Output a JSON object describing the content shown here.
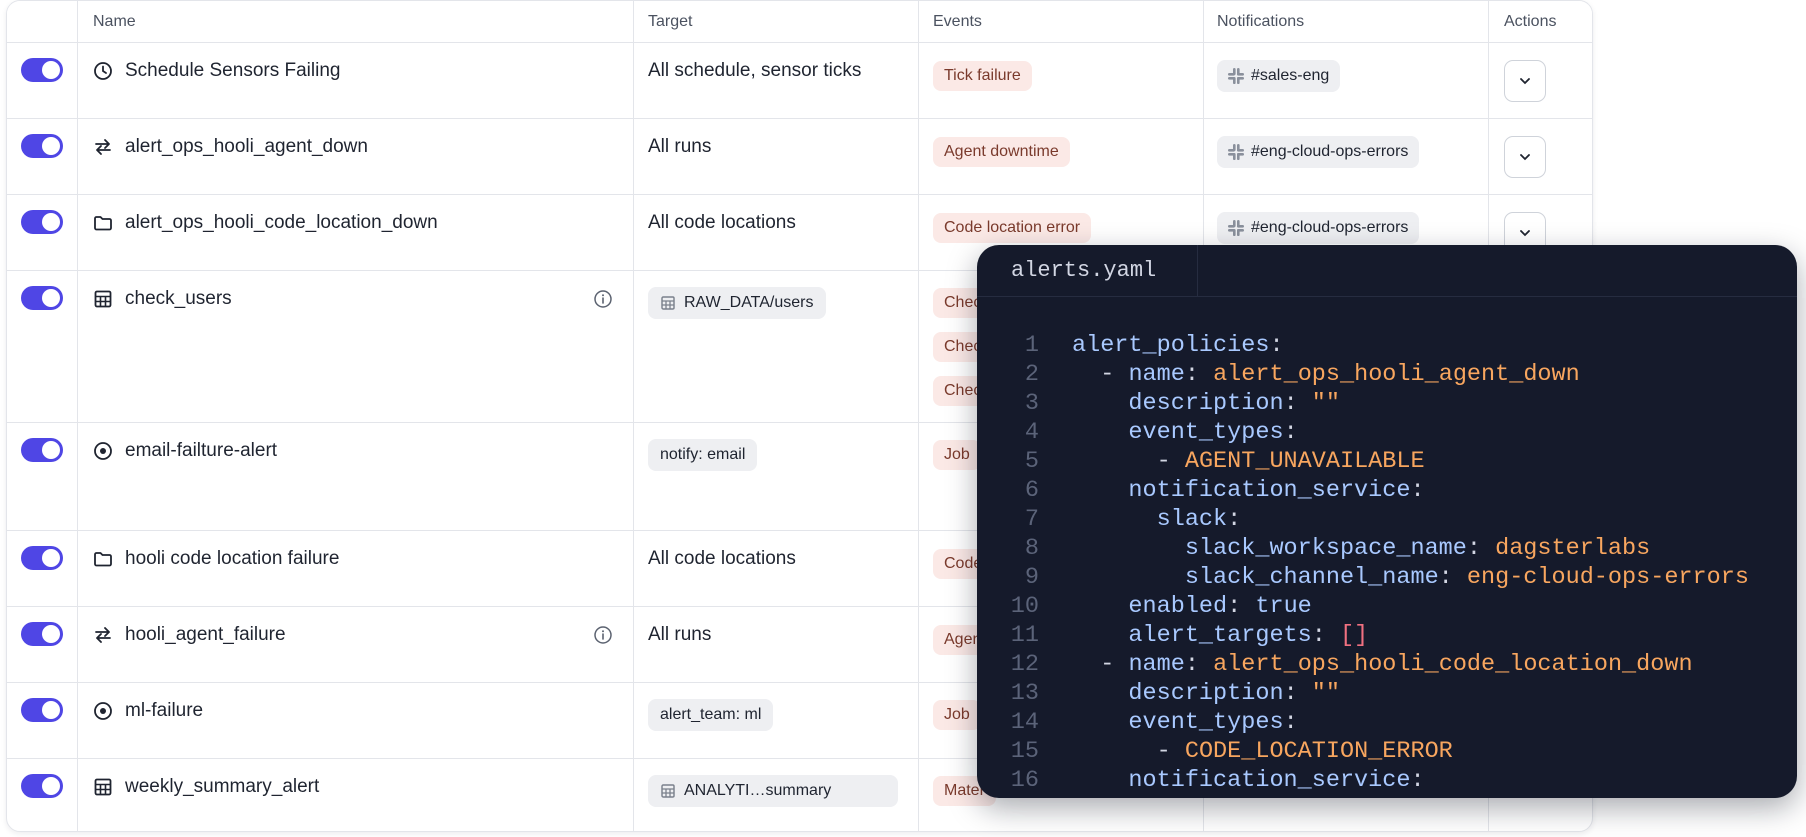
{
  "table": {
    "headers": [
      "Name",
      "Target",
      "Events",
      "Notifications",
      "Actions"
    ],
    "rows": [
      {
        "name": "Schedule Sensors Failing",
        "icon": "clock-icon",
        "target": "All schedule, sensor ticks",
        "target_type": "text",
        "events": [
          "Tick failure"
        ],
        "notification": "#sales-eng",
        "enabled": true
      },
      {
        "name": "alert_ops_hooli_agent_down",
        "icon": "swap-arrows-icon",
        "target": "All runs",
        "target_type": "text",
        "events": [
          "Agent downtime"
        ],
        "notification": "#eng-cloud-ops-errors",
        "enabled": true
      },
      {
        "name": "alert_ops_hooli_code_location_down",
        "icon": "folder-icon",
        "target": "All code locations",
        "target_type": "text",
        "events": [
          "Code location error"
        ],
        "notification": "#eng-cloud-ops-errors",
        "enabled": true
      },
      {
        "name": "check_users",
        "icon": "table-icon",
        "target": "RAW_DATA/users",
        "target_type": "asset-chip",
        "events": [
          "Chec",
          "Chec",
          "Chec"
        ],
        "enabled": true,
        "has_info": true
      },
      {
        "name": "email-failture-alert",
        "icon": "target-icon",
        "target": "notify: email",
        "target_type": "tag-chip",
        "events": [
          "Job"
        ],
        "enabled": true
      },
      {
        "name": "hooli code location failure",
        "icon": "folder-icon",
        "target": "All code locations",
        "target_type": "text",
        "events": [
          "Code"
        ],
        "enabled": true
      },
      {
        "name": "hooli_agent_failure",
        "icon": "swap-arrows-icon",
        "target": "All runs",
        "target_type": "text",
        "events": [
          "Agen"
        ],
        "enabled": true,
        "has_info": true
      },
      {
        "name": "ml-failure",
        "icon": "target-icon",
        "target": "alert_team: ml",
        "target_type": "tag-chip",
        "events": [
          "Job"
        ],
        "enabled": true
      },
      {
        "name": "weekly_summary_alert",
        "icon": "table-icon",
        "target": "ANALYTI…summary",
        "target_type": "asset-chip",
        "events": [
          "Mater"
        ],
        "enabled": true
      }
    ]
  },
  "code_panel": {
    "filename": "alerts.yaml",
    "lines": [
      {
        "n": "1",
        "text": "alert_policies:"
      },
      {
        "n": "2",
        "text": "  - name: alert_ops_hooli_agent_down"
      },
      {
        "n": "3",
        "text": "    description: \"\""
      },
      {
        "n": "4",
        "text": "    event_types:"
      },
      {
        "n": "5",
        "text": "      - AGENT_UNAVAILABLE"
      },
      {
        "n": "6",
        "text": "    notification_service:"
      },
      {
        "n": "7",
        "text": "      slack:"
      },
      {
        "n": "8",
        "text": "        slack_workspace_name: dagsterlabs"
      },
      {
        "n": "9",
        "text": "        slack_channel_name: eng-cloud-ops-errors"
      },
      {
        "n": "10",
        "text": "    enabled: true"
      },
      {
        "n": "11",
        "text": "    alert_targets: []"
      },
      {
        "n": "12",
        "text": "  - name: alert_ops_hooli_code_location_down"
      },
      {
        "n": "13",
        "text": "    description: \"\""
      },
      {
        "n": "14",
        "text": "    event_types:"
      },
      {
        "n": "15",
        "text": "      - CODE_LOCATION_ERROR"
      },
      {
        "n": "16",
        "text": "    notification_service:"
      }
    ]
  },
  "colors": {
    "toggle_on": "#4f46e5",
    "event_chip_bg": "#fbe9e6",
    "code_bg": "#151a2b",
    "yaml_key": "#a9c9ff",
    "yaml_string": "#f8a65f"
  }
}
